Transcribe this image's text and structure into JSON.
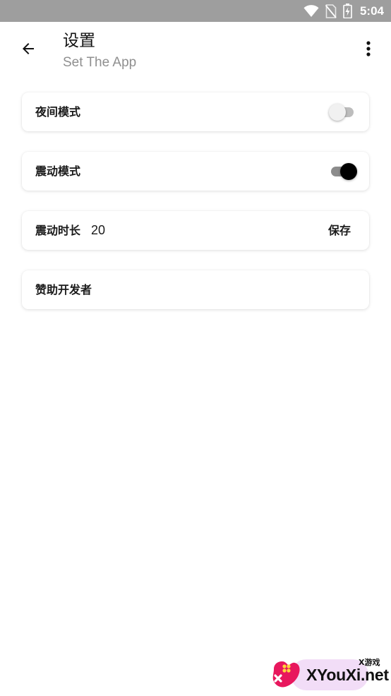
{
  "status_bar": {
    "time": "5:04",
    "icons": [
      "wifi-icon",
      "no-sim-icon",
      "battery-charging-icon"
    ]
  },
  "app_bar": {
    "title": "设置",
    "subtitle": "Set The App",
    "back_icon": "arrow-back-icon",
    "more_icon": "more-vert-icon"
  },
  "settings": {
    "night_mode": {
      "label": "夜间模式",
      "enabled": false
    },
    "vibration_mode": {
      "label": "震动模式",
      "enabled": true
    },
    "vibration_duration": {
      "label": "震动时长",
      "value": "20",
      "save_label": "保存"
    },
    "sponsor": {
      "label": "赞助开发者"
    }
  },
  "watermark": {
    "tag": "X游戏",
    "brand": "XYouXi.net"
  },
  "colors": {
    "status_bar": "#9e9e9e",
    "switch_on_thumb": "#000000",
    "switch_off_thumb": "#f1f1f1",
    "subtitle": "#8f8f8f"
  }
}
